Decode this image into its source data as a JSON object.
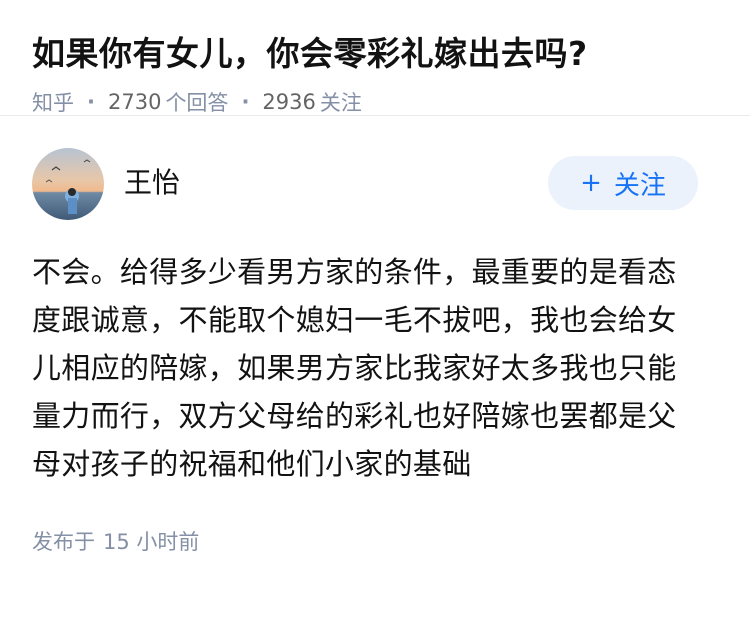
{
  "question": {
    "title": "如果你有女儿，你会零彩礼嫁出去吗?",
    "source": "知乎",
    "answer_count": "2730",
    "answer_label": "个回答",
    "follower_count": "2936",
    "follower_label": "关注"
  },
  "answer": {
    "author_name": "王怡",
    "follow_button": "关注",
    "content": "不会。给得多少看男方家的条件，最重要的是看态度跟诚意，不能取个媳妇一毛不拔吧，我也会给女儿相应的陪嫁，如果男方家比我家好太多我也只能量力而行，双方父母给的彩礼也好陪嫁也罢都是父母对孩子的祝福和他们小家的基础",
    "published_label": "发布于",
    "published_time": "15 小时前"
  },
  "colors": {
    "accent": "#1772f6",
    "meta": "#8590a6",
    "button_bg": "#ebf2fb"
  },
  "icons": {
    "follow_plus": "plus-icon"
  }
}
